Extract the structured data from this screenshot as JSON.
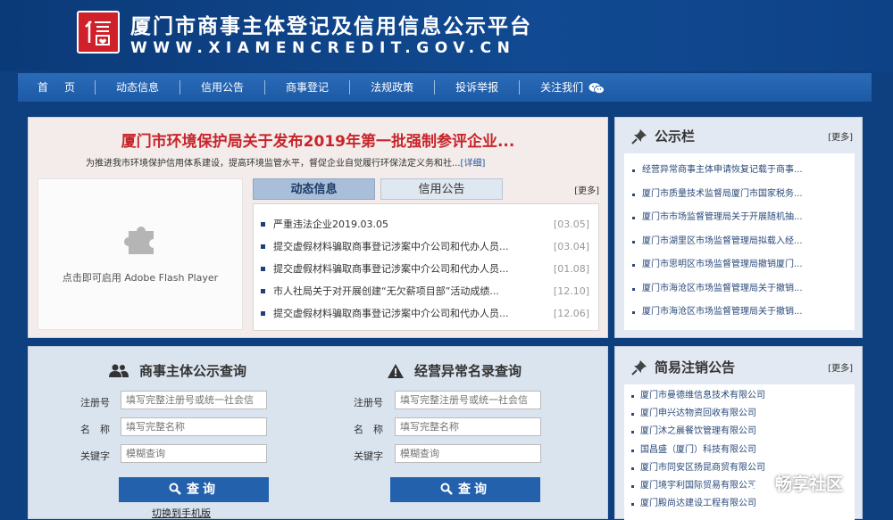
{
  "header": {
    "title": "厦门市商事主体登记及信用信息公示平台",
    "domain": "WWW.XIAMENCREDIT.GOV.CN",
    "logo_char": "信"
  },
  "nav": {
    "items": [
      "首页",
      "动态信息",
      "信用公告",
      "商事登记",
      "法规政策",
      "投诉举报",
      "关注我们"
    ]
  },
  "featured": {
    "headline": "厦门市环境保护局关于发布2019年第一批强制参评企业...",
    "summary": "为推进我市环境保护信用体系建设，提高环境监管水平，督促企业自觉履行环保法定义务和社...",
    "detail_link": "[详细]"
  },
  "flash": {
    "text": "点击即可启用 Adobe Flash Player"
  },
  "news_tabs": {
    "tabs": [
      "动态信息",
      "信用公告"
    ],
    "more": "[更多]",
    "items": [
      {
        "title": "严重违法企业2019.03.05",
        "date": "[03.05]"
      },
      {
        "title": "提交虚假材料骗取商事登记涉案中介公司和代办人员...",
        "date": "[03.04]"
      },
      {
        "title": "提交虚假材料骗取商事登记涉案中介公司和代办人员...",
        "date": "[01.08]"
      },
      {
        "title": "市人社局关于对开展创建“无欠薪项目部”活动成绩...",
        "date": "[12.10]"
      },
      {
        "title": "提交虚假材料骗取商事登记涉案中介公司和代办人员...",
        "date": "[12.06]"
      }
    ]
  },
  "bulletin": {
    "title": "公示栏",
    "more": "[更多]",
    "items": [
      "经营异常商事主体申请恢复记载于商事...",
      "厦门市质量技术监督局厦门市国家税务...",
      "厦门市市场监督管理局关于开展随机抽...",
      "厦门市湖里区市场监督管理局拟载入经...",
      "厦门市思明区市场监督管理局撤销厦门...",
      "厦门市海沧区市场监督管理局关于撤销...",
      "厦门市海沧区市场监督管理局关于撤销..."
    ]
  },
  "query_entity": {
    "title": "商事主体公示查询",
    "labels": [
      "注册号",
      "名　称",
      "关键字"
    ],
    "placeholders": [
      "填写完整注册号或统一社会信",
      "填写完整名称",
      "模糊查询"
    ],
    "button": "查询"
  },
  "query_abnormal": {
    "title": "经营异常名录查询",
    "labels": [
      "注册号",
      "名　称",
      "关键字"
    ],
    "placeholders": [
      "填写完整注册号或统一社会信",
      "填写完整名称",
      "模糊查询"
    ],
    "button": "查询"
  },
  "mobile_link": "切换到手机版",
  "simple_cancel": {
    "title": "简易注销公告",
    "more": "[更多]",
    "items": [
      "厦门市曼德维信息技术有限公司",
      "厦门申兴达物资回收有限公司",
      "厦门沐之晨餐饮管理有限公司",
      "国昌盛（厦门）科技有限公司",
      "厦门市同安区扬昆商贸有限公司",
      "厦门境宇利国际贸易有限公司",
      "厦门殿尚达建设工程有限公司"
    ]
  },
  "watermark": "畅享社区",
  "colors": {
    "header_bg": "#0e3f7e",
    "nav_bg": "#1e5aa5",
    "headline_red": "#c7252b",
    "button_blue": "#2461ad"
  }
}
